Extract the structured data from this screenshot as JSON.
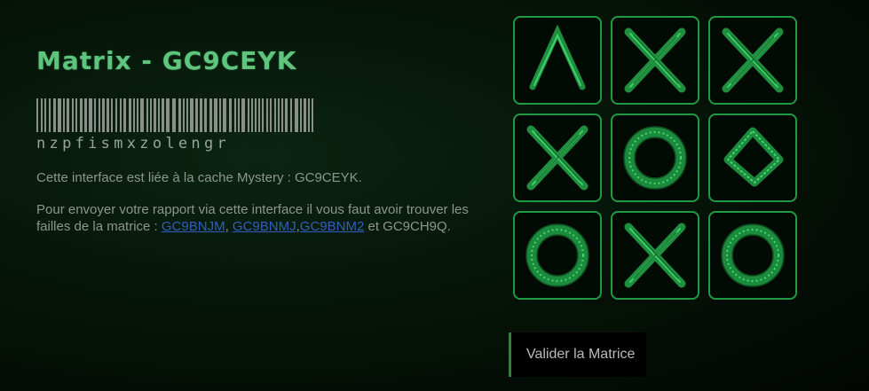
{
  "title": "Matrix - GC9CEYK",
  "barcode_text": "nzpfismxzolengr",
  "info_line1": "Cette interface est liée à la cache Mystery : GC9CEYK.",
  "info_line2": {
    "prefix": "Pour envoyer votre rapport via cette interface il vous faut avoir trouver les failles de la matrice : ",
    "links": [
      "GC9BNJM",
      "GC9BNMJ",
      "GC9BNM2"
    ],
    "sep1": ", ",
    "sep2": ",",
    "suffix": " et GC9CH9Q."
  },
  "matrix": {
    "cells": [
      {
        "symbol": "caret"
      },
      {
        "symbol": "x"
      },
      {
        "symbol": "x"
      },
      {
        "symbol": "x"
      },
      {
        "symbol": "o"
      },
      {
        "symbol": "diamond"
      },
      {
        "symbol": "o"
      },
      {
        "symbol": "x"
      },
      {
        "symbol": "o"
      }
    ]
  },
  "submit_label": "Valider la Matrice",
  "colors": {
    "accent": "#1f9a44",
    "title": "#5fc47d",
    "link": "#2f5fbd",
    "text": "#8d968d"
  }
}
